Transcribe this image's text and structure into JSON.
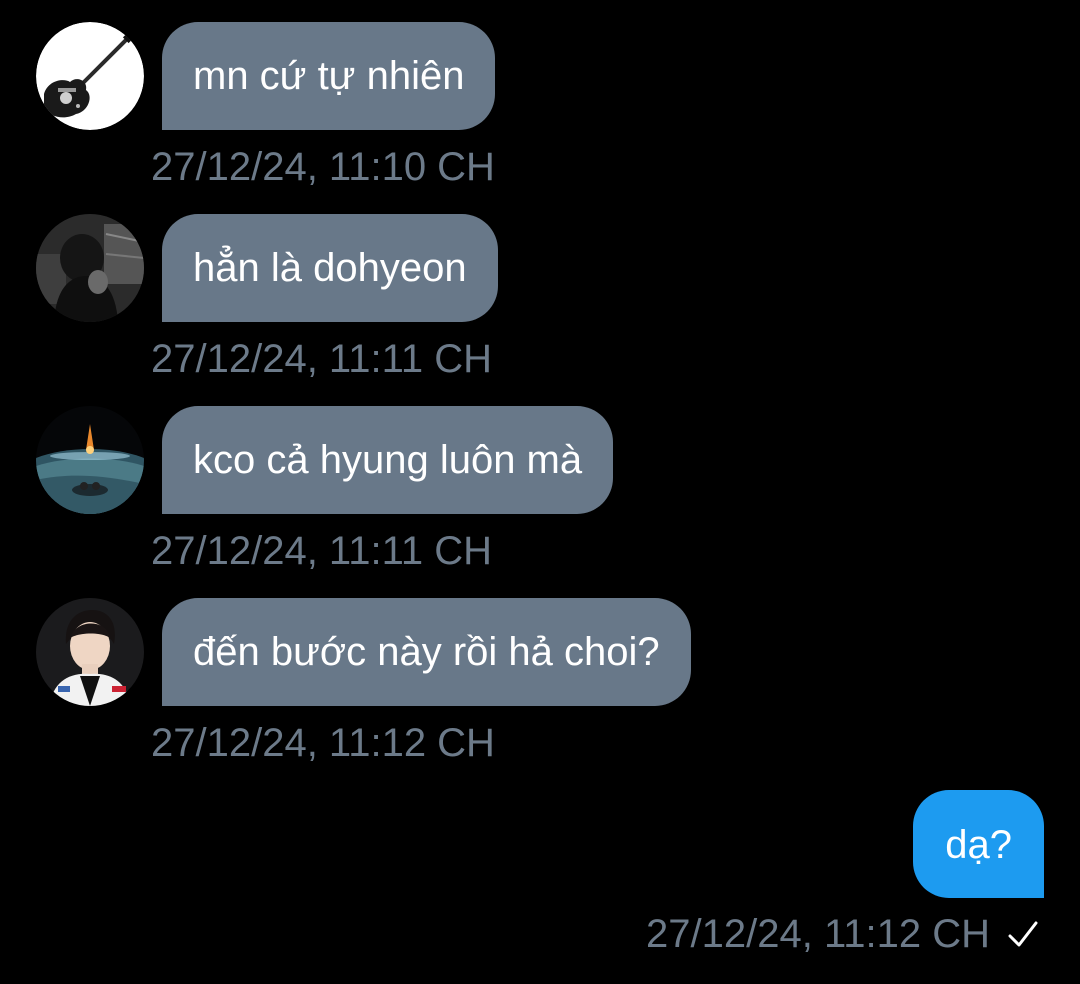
{
  "messages": [
    {
      "text": "mn cứ tự nhiên",
      "time": "27/12/24, 11:10 CH",
      "avatar": "guitar-avatar"
    },
    {
      "text": "hẳn là dohyeon",
      "time": "27/12/24, 11:11 CH",
      "avatar": "hooded-person-avatar"
    },
    {
      "text": "kco cả hyung luôn mà",
      "time": "27/12/24, 11:11 CH",
      "avatar": "earth-meteor-avatar"
    },
    {
      "text": "đến bước này rồi hả choi?",
      "time": "27/12/24, 11:12 CH",
      "avatar": "young-man-avatar"
    }
  ],
  "outgoing": {
    "text": "dạ?",
    "time": "27/12/24, 11:12 CH",
    "status_icon": "check-icon"
  },
  "colors": {
    "background": "#000000",
    "incoming_bubble": "#687889",
    "outgoing_bubble": "#1d9bf0",
    "timestamp": "#6c7a89",
    "text": "#ffffff"
  }
}
